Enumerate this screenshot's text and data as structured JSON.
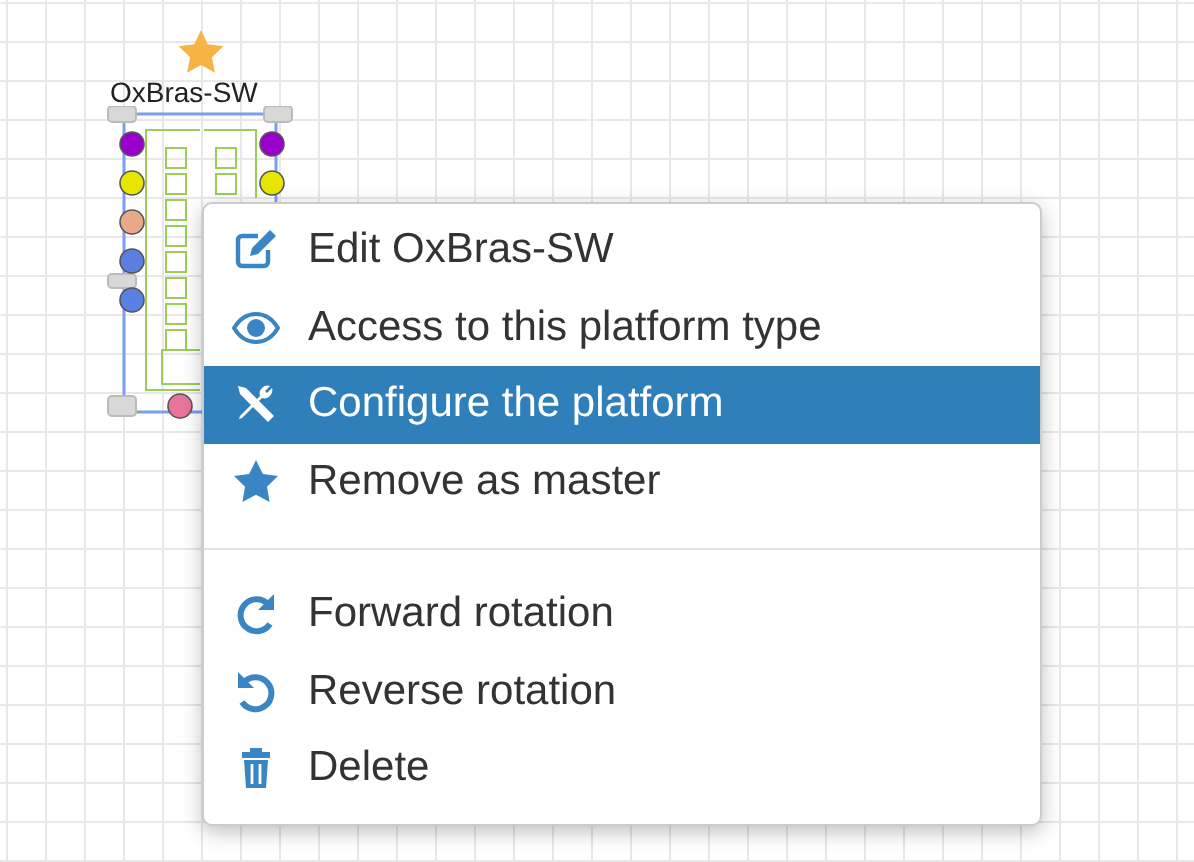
{
  "canvas": {
    "node": {
      "label": "OxBras-SW",
      "master": true,
      "selected": true,
      "left_ports": [
        {
          "color": "#9900cc"
        },
        {
          "color": "#e6e600"
        },
        {
          "color": "#e8a88a"
        },
        {
          "color": "#5b7fe0"
        },
        {
          "color": "#5b7fe0"
        }
      ],
      "right_ports": [
        {
          "color": "#9900cc"
        },
        {
          "color": "#e6e600"
        }
      ],
      "bottom_ports": [
        {
          "color": "#e8749a"
        }
      ]
    }
  },
  "context_menu": {
    "sections": [
      [
        {
          "kind": "edit",
          "label": "Edit OxBras-SW",
          "selected": false
        },
        {
          "kind": "view",
          "label": "Access to this platform type",
          "selected": false
        },
        {
          "kind": "configure",
          "label": "Configure the platform",
          "selected": true
        },
        {
          "kind": "master",
          "label": "Remove as master",
          "selected": false
        }
      ],
      [
        {
          "kind": "forward",
          "label": "Forward rotation",
          "selected": false
        },
        {
          "kind": "reverse",
          "label": "Reverse rotation",
          "selected": false
        },
        {
          "kind": "delete",
          "label": "Delete",
          "selected": false
        }
      ]
    ]
  }
}
